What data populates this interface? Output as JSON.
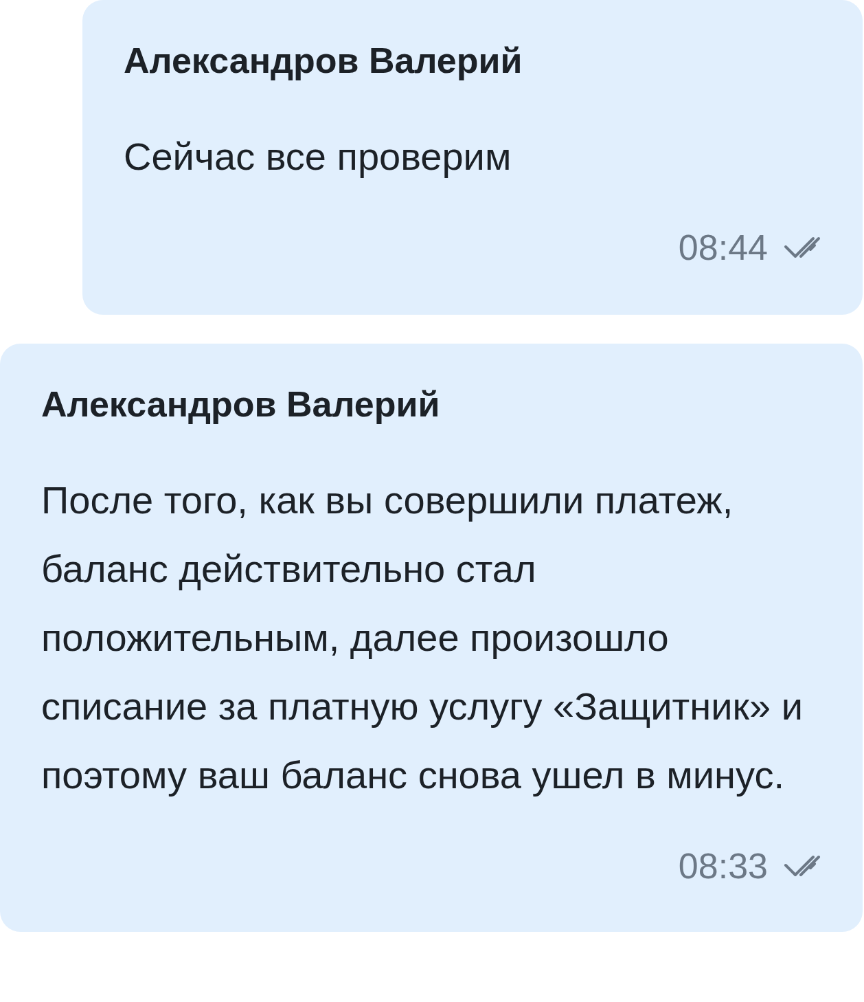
{
  "messages": [
    {
      "sender": "Александров Валерий",
      "text": "Сейчас все проверим",
      "time": "08:44",
      "read": true,
      "indent": true
    },
    {
      "sender": "Александров Валерий",
      "text": "После того, как вы совершили платеж, баланс действительно стал положительным, далее произошло списание за платную услугу «Защитник» и поэтому ваш баланс снова ушел в минус.",
      "time": "08:33",
      "read": true,
      "indent": false
    }
  ]
}
